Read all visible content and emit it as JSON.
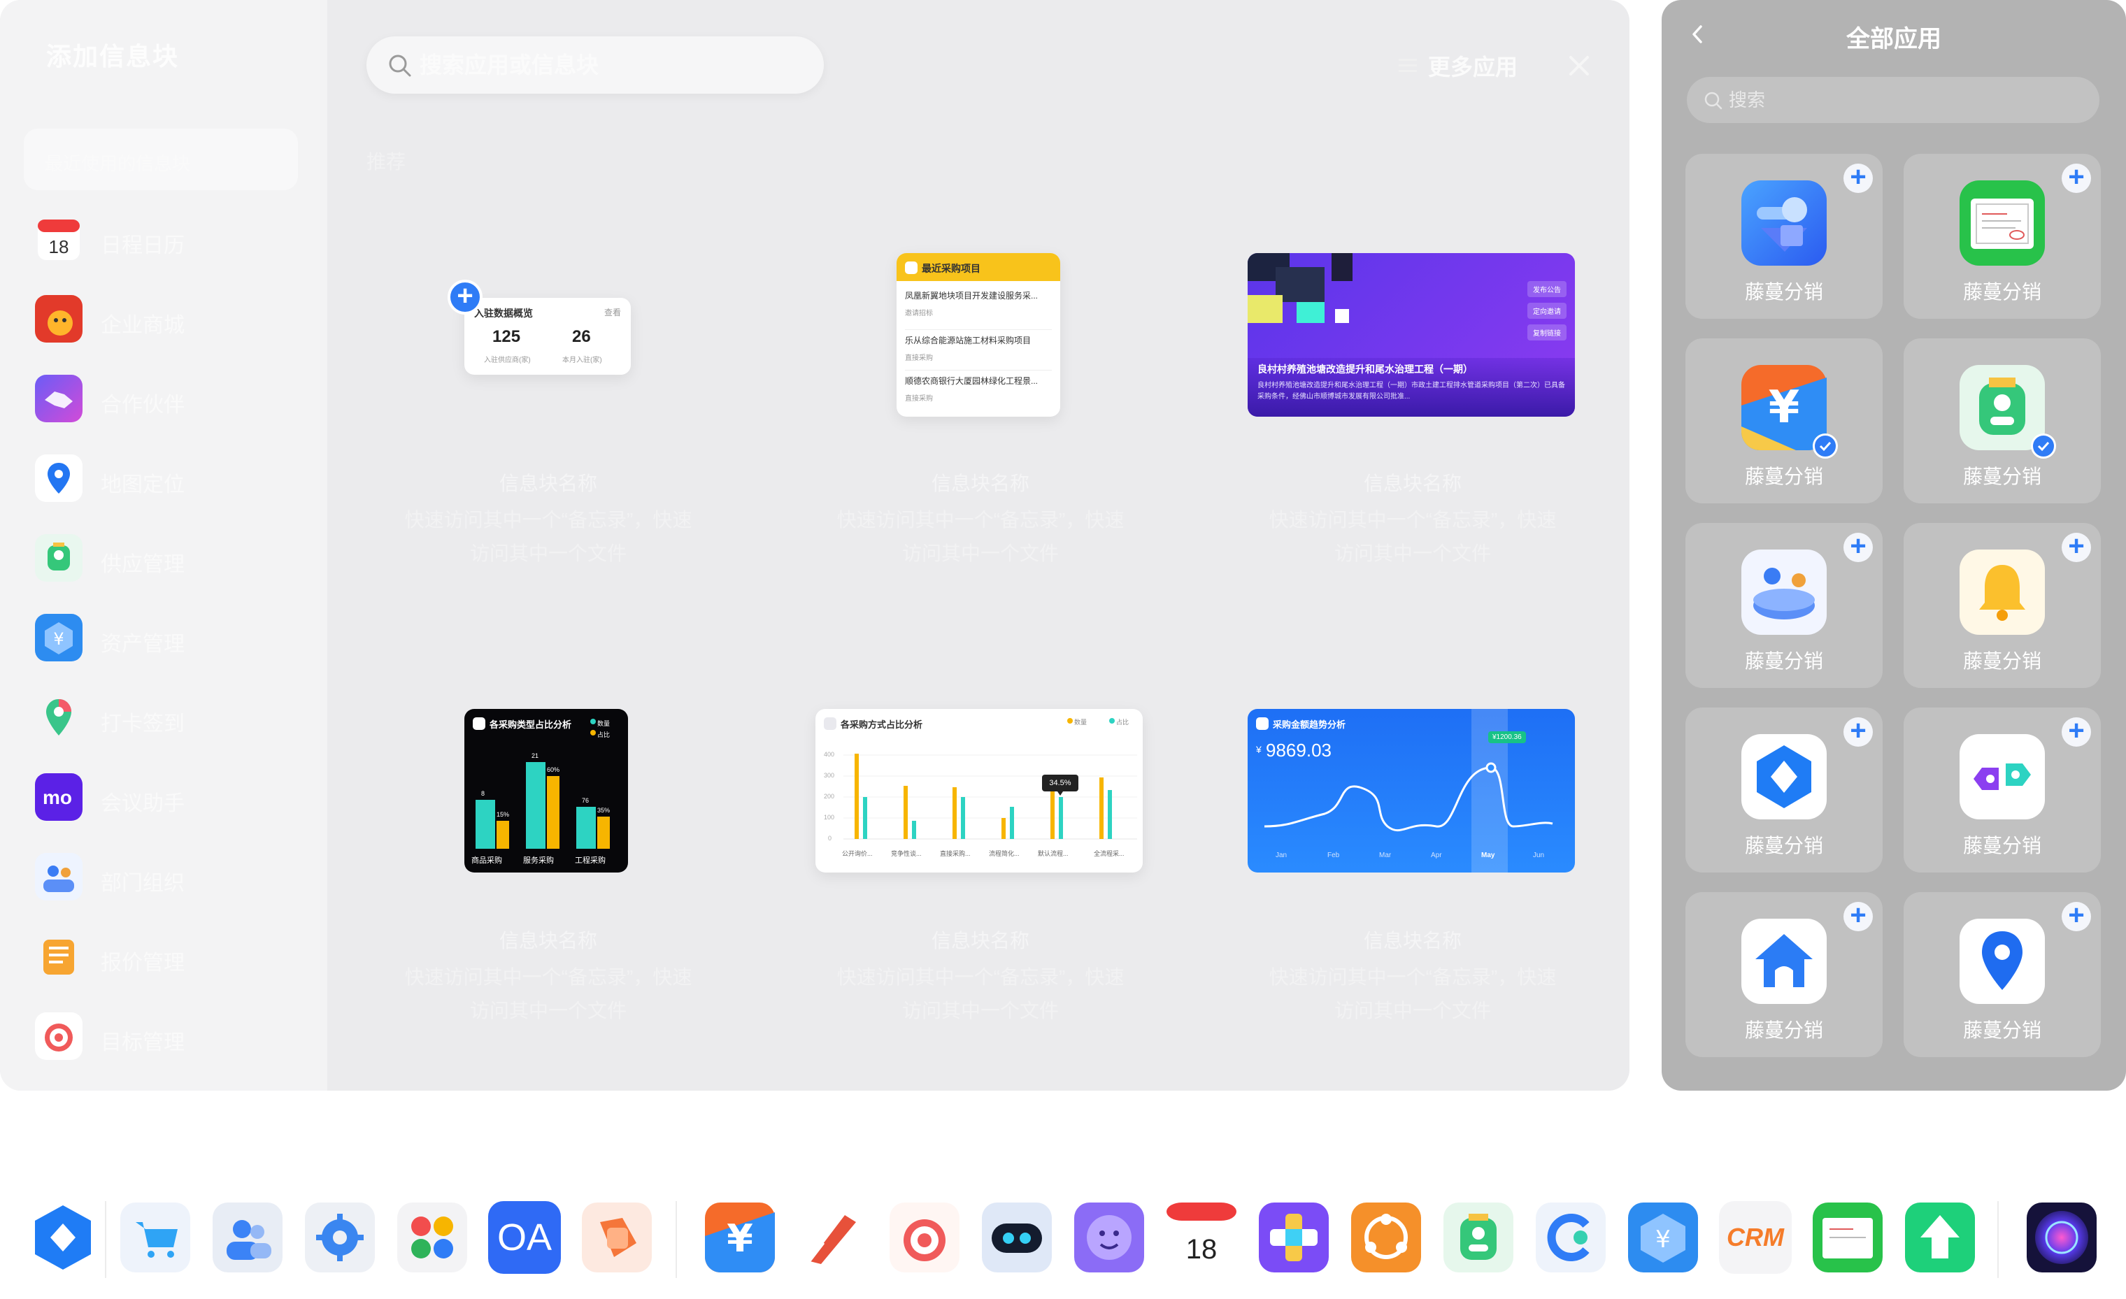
{
  "sidebar": {
    "title": "添加信息块",
    "active_item": "最近使用的信息块",
    "items": [
      {
        "label": "日程日历",
        "icon": "calendar-icon"
      },
      {
        "label": "企业商城",
        "icon": "mall-icon"
      },
      {
        "label": "合作伙伴",
        "icon": "handshake-icon"
      },
      {
        "label": "地图定位",
        "icon": "location-pin-icon"
      },
      {
        "label": "供应管理",
        "icon": "supplier-badge-icon"
      },
      {
        "label": "资产管理",
        "icon": "asset-yuan-icon"
      },
      {
        "label": "打卡签到",
        "icon": "map-pin-icon"
      },
      {
        "label": "会议助手",
        "icon": "mo-logo-icon"
      },
      {
        "label": "部门组织",
        "icon": "org-people-icon"
      },
      {
        "label": "报价管理",
        "icon": "quote-folder-icon"
      },
      {
        "label": "目标管理",
        "icon": "target-icon"
      }
    ]
  },
  "search": {
    "placeholder": "搜索应用或信息块"
  },
  "header": {
    "more_apps_label": "更多应用"
  },
  "section_label": "推荐",
  "widgets": [
    {
      "name": "信息块名称",
      "desc": "快速访问其中一个“备忘录”，快速访问其中一个文件"
    },
    {
      "name": "信息块名称",
      "desc": "快速访问其中一个“备忘录”，快速访问其中一个文件"
    },
    {
      "name": "信息块名称",
      "desc": "快速访问其中一个“备忘录”，快速访问其中一个文件"
    },
    {
      "name": "信息块名称",
      "desc": "快速访问其中一个“备忘录”，快速访问其中一个文件"
    },
    {
      "name": "信息块名称",
      "desc": "快速访问其中一个“备忘录”，快速访问其中一个文件"
    },
    {
      "name": "信息块名称",
      "desc": "快速访问其中一个“备忘录”，快速访问其中一个文件"
    }
  ],
  "entry_widget": {
    "title": "入驻数据概览",
    "more": "查看",
    "stats": [
      {
        "value": "125",
        "label": "入驻供应商(家)"
      },
      {
        "value": "26",
        "label": "本月入驻(家)"
      }
    ]
  },
  "procure_widget": {
    "title": "最近采购项目",
    "items": [
      {
        "title": "凤凰新翼地块项目开发建设服务采...",
        "tag": "邀请招标"
      },
      {
        "title": "乐从综合能源站施工材料采购项目",
        "tag": "直接采购"
      },
      {
        "title": "顺德农商银行大厦园林绿化工程景...",
        "tag": "直接采购"
      }
    ]
  },
  "banner_widget": {
    "title": "良村村养殖池塘改造提升和尾水治理工程（一期）",
    "desc": "良村村养殖池塘改造提升和尾水治理工程（一期）市政土建工程排水管道采购项目（第二次）已具备采购条件，经佛山市顺博城市发展有限公司批准...",
    "actions": [
      "发布公告",
      "定向邀请",
      "复制链接"
    ]
  },
  "bar_widget": {
    "title": "各采购类型占比分析",
    "legend": [
      "数量",
      "占比"
    ],
    "value_labels": [
      "8",
      "15%",
      "21",
      "60%",
      "76",
      "35%"
    ],
    "categories": [
      "商品采购",
      "服务采购",
      "工程采购"
    ]
  },
  "method_widget": {
    "title": "各采购方式占比分析",
    "legend": [
      "数量",
      "占比"
    ],
    "y_ticks": [
      "400",
      "300",
      "200",
      "100",
      "0"
    ],
    "tooltip": "34.5%",
    "categories": [
      "公开询价...",
      "竞争性谈...",
      "直接采购...",
      "流程简化...",
      "默认流程...",
      "全流程采..."
    ]
  },
  "trend_widget": {
    "title": "采购金额趋势分析",
    "currency": "¥",
    "amount": "9869.03",
    "tooltip": "¥1200.36",
    "months": [
      "Jan",
      "Feb",
      "Mar",
      "Apr",
      "May",
      "Jun"
    ],
    "active_month": "May"
  },
  "right_panel": {
    "title": "全部应用",
    "search_placeholder": "搜索",
    "apps": [
      {
        "label": "藤蔓分销",
        "icon": "cube-app-icon",
        "added": false
      },
      {
        "label": "藤蔓分销",
        "icon": "invoice-app-icon",
        "added": false
      },
      {
        "label": "藤蔓分销",
        "icon": "yuan-app-icon",
        "added": true
      },
      {
        "label": "藤蔓分销",
        "icon": "supplier-badge-icon",
        "added": true
      },
      {
        "label": "藤蔓分销",
        "icon": "meeting-app-icon",
        "added": false
      },
      {
        "label": "藤蔓分销",
        "icon": "bell-icon",
        "added": false
      },
      {
        "label": "藤蔓分销",
        "icon": "hexagon-app-icon",
        "added": false
      },
      {
        "label": "藤蔓分销",
        "icon": "link-app-icon",
        "added": false
      },
      {
        "label": "藤蔓分销",
        "icon": "home-app-icon",
        "added": false
      },
      {
        "label": "藤蔓分销",
        "icon": "location-pin-icon",
        "added": false
      }
    ]
  },
  "dock": {
    "apps": [
      {
        "icon": "hexagon-app-icon"
      },
      {
        "icon": "cart-icon"
      },
      {
        "icon": "contacts-icon"
      },
      {
        "icon": "settings-gear-icon"
      },
      {
        "icon": "app-grid-icon"
      },
      {
        "icon": "oa-icon",
        "text": "OA"
      },
      {
        "icon": "tag-icon"
      },
      {
        "icon": "yuan-app-icon"
      },
      {
        "icon": "quill-icon"
      },
      {
        "icon": "target-icon"
      },
      {
        "icon": "robot-icon"
      },
      {
        "icon": "smile-icon"
      },
      {
        "icon": "calendar-icon"
      },
      {
        "icon": "puzzle-icon"
      },
      {
        "icon": "share-icon"
      },
      {
        "icon": "supplier-badge-icon"
      },
      {
        "icon": "c-logo-icon"
      },
      {
        "icon": "asset-yuan-icon"
      },
      {
        "icon": "crm-icon",
        "text": "CRM"
      },
      {
        "icon": "invoice-app-icon"
      },
      {
        "icon": "upload-arrow-icon"
      },
      {
        "icon": "orb-icon"
      }
    ]
  },
  "colors": {
    "accent": "#2f7cf6",
    "panel_gray": "#b3b3b3",
    "banner_purple": "#6c3ef0",
    "chart_teal": "#2dd3c2",
    "chart_yellow": "#f7b500"
  }
}
